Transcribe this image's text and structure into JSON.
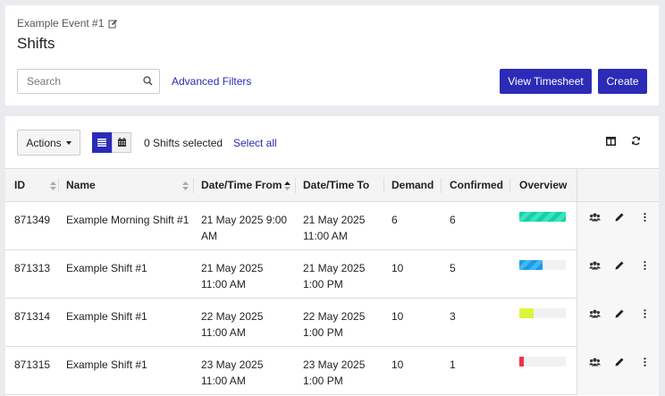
{
  "header": {
    "event_name": "Example Event #1",
    "title": "Shifts",
    "search_placeholder": "Search",
    "advanced_filters": "Advanced Filters",
    "view_timesheet": "View Timesheet",
    "create": "Create"
  },
  "toolbar": {
    "actions": "Actions",
    "selected_count": "0 Shifts selected",
    "select_all": "Select all"
  },
  "table": {
    "columns": [
      "ID",
      "Name",
      "Date/Time From",
      "Date/Time To",
      "Demand",
      "Confirmed",
      "Overview"
    ],
    "rows": [
      {
        "id": "871349",
        "name": "Example Morning Shift #1",
        "from": [
          "21 May 2025 9:00",
          "AM"
        ],
        "to": [
          "21 May 2025",
          "11:00 AM"
        ],
        "demand": "6",
        "confirmed": "6",
        "fill_fraction": 1.0
      },
      {
        "id": "871313",
        "name": "Example Shift #1",
        "from": [
          "21 May 2025",
          "11:00 AM"
        ],
        "to": [
          "21 May 2025",
          "1:00 PM"
        ],
        "demand": "10",
        "confirmed": "5",
        "fill_fraction": 0.5
      },
      {
        "id": "871314",
        "name": "Example Shift #1",
        "from": [
          "22 May 2025",
          "11:00 AM"
        ],
        "to": [
          "22 May 2025",
          "1:00 PM"
        ],
        "demand": "10",
        "confirmed": "3",
        "fill_fraction": 0.3
      },
      {
        "id": "871315",
        "name": "Example Shift #1",
        "from": [
          "23 May 2025",
          "11:00 AM"
        ],
        "to": [
          "23 May 2025",
          "1:00 PM"
        ],
        "demand": "10",
        "confirmed": "1",
        "fill_fraction": 0.1
      }
    ]
  },
  "colors": {
    "primary": "#2b2bb8",
    "link": "#2a2ab5",
    "overview_full": "#14d1a4",
    "overview_half": "#1b9be8",
    "overview_third": "#dcf53a",
    "overview_low": "#ef3247"
  },
  "icons": {
    "edit": "edit-icon",
    "search": "search-icon",
    "list_view": "list-icon",
    "calendar_view": "calendar-icon",
    "columns": "columns-icon",
    "refresh": "refresh-icon",
    "sort": "sort-icon",
    "sort_asc": "sort-asc-icon",
    "users": "users-icon",
    "pencil": "pencil-icon",
    "more": "more-vertical-icon"
  }
}
